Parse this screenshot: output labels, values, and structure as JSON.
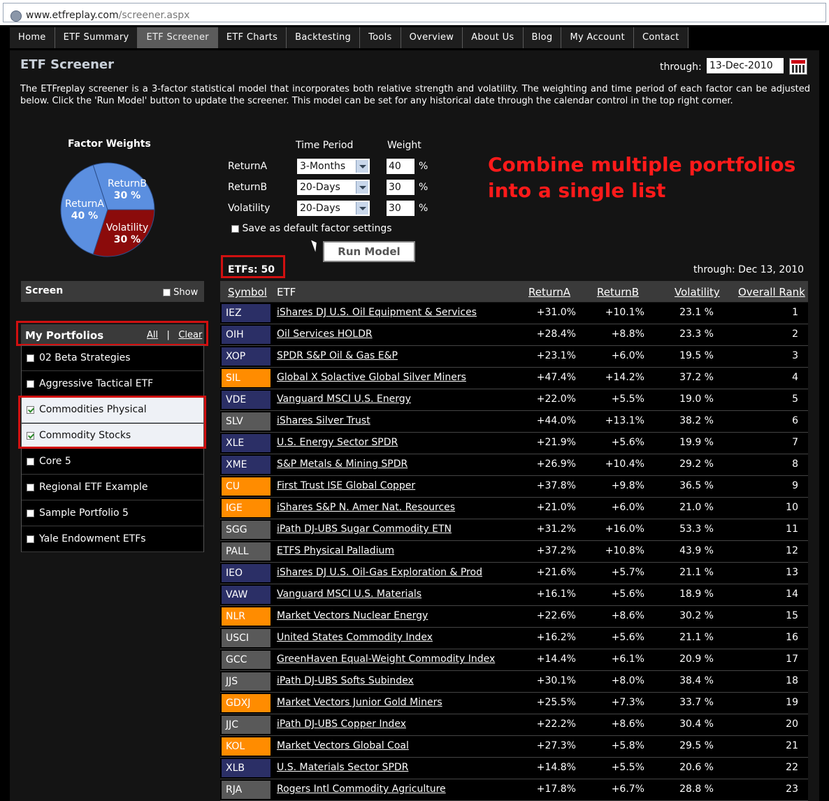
{
  "browser": {
    "url_domain": "www.etfreplay.com",
    "url_path": "/screener.aspx"
  },
  "nav": [
    "Home",
    "ETF Summary",
    "ETF Screener",
    "ETF Charts",
    "Backtesting",
    "Tools",
    "Overview",
    "About Us",
    "Blog",
    "My Account",
    "Contact"
  ],
  "nav_active": "ETF Screener",
  "page": {
    "title": "ETF Screener",
    "through_label": "through:",
    "through_date": "13-Dec-2010",
    "intro": "The ETFreplay screener is a 3-factor statistical model that incorporates both relative strength and volatility. The weighting and time period of each factor can be adjusted below. Click the 'Run Model' button to update the screener. This model can be set for any historical date through the calendar control in the top right corner."
  },
  "factor_weights": {
    "title": "Factor Weights",
    "slices": [
      {
        "name": "ReturnA",
        "pct_label": "40 %",
        "value": 40,
        "color": "#5b8fe0"
      },
      {
        "name": "ReturnB",
        "pct_label": "30 %",
        "value": 30,
        "color": "#5b8fe0"
      },
      {
        "name": "Volatility",
        "pct_label": "30 %",
        "value": 30,
        "color": "#8b0b0b"
      }
    ]
  },
  "factors": {
    "time_period_header": "Time Period",
    "weight_header": "Weight",
    "rows": [
      {
        "label": "ReturnA",
        "period": "3-Months",
        "weight": "40",
        "unit": "%"
      },
      {
        "label": "ReturnB",
        "period": "20-Days",
        "weight": "30",
        "unit": "%"
      },
      {
        "label": "Volatility",
        "period": "20-Days",
        "weight": "30",
        "unit": "%"
      }
    ],
    "save_default_label": "Save as default factor settings",
    "run_button": "Run Model"
  },
  "annotation": {
    "line1": "Combine multiple portfolios",
    "line2": "into a single list"
  },
  "results": {
    "count_label": "ETFs: 50",
    "through_label": "through: Dec 13, 2010"
  },
  "screen": {
    "title": "Screen",
    "show_label": "Show"
  },
  "portfolios": {
    "title": "My Portfolios",
    "all_link": "All",
    "separator": "|",
    "clear_link": "Clear",
    "items": [
      {
        "label": "02 Beta Strategies",
        "checked": false
      },
      {
        "label": "Aggressive Tactical ETF",
        "checked": false
      },
      {
        "label": "Commodities Physical",
        "checked": true
      },
      {
        "label": "Commodity Stocks",
        "checked": true
      },
      {
        "label": "Core 5",
        "checked": false
      },
      {
        "label": "Regional ETF Example",
        "checked": false
      },
      {
        "label": "Sample Portfolio 5",
        "checked": false
      },
      {
        "label": "Yale Endowment ETFs",
        "checked": false
      }
    ]
  },
  "table": {
    "headers": {
      "symbol": "Symbol",
      "etf": "ETF",
      "returnA": "ReturnA",
      "returnB": "ReturnB",
      "volatility": "Volatility",
      "rank": "Overall Rank"
    },
    "symbol_colors": {
      "navy": "#2b2f66",
      "orange": "#ff8c00",
      "gray": "#595959"
    },
    "rows": [
      {
        "symbol": "IEZ",
        "color": "navy",
        "name": "iShares DJ U.S. Oil Equipment & Services",
        "returnA": "+31.0%",
        "returnB": "+10.1%",
        "volatility": "23.1 %",
        "rank": "1"
      },
      {
        "symbol": "OIH",
        "color": "navy",
        "name": "Oil Services HOLDR",
        "returnA": "+28.4%",
        "returnB": "+8.8%",
        "volatility": "23.3 %",
        "rank": "2"
      },
      {
        "symbol": "XOP",
        "color": "navy",
        "name": "SPDR S&P Oil & Gas E&P",
        "returnA": "+23.1%",
        "returnB": "+6.0%",
        "volatility": "19.5 %",
        "rank": "3"
      },
      {
        "symbol": "SIL",
        "color": "orange",
        "name": "Global X Solactive Global Silver Miners",
        "returnA": "+47.4%",
        "returnB": "+14.2%",
        "volatility": "37.2 %",
        "rank": "4"
      },
      {
        "symbol": "VDE",
        "color": "navy",
        "name": "Vanguard MSCI U.S. Energy",
        "returnA": "+22.0%",
        "returnB": "+5.5%",
        "volatility": "19.0 %",
        "rank": "5"
      },
      {
        "symbol": "SLV",
        "color": "gray",
        "name": "iShares Silver Trust",
        "returnA": "+44.0%",
        "returnB": "+13.1%",
        "volatility": "38.2 %",
        "rank": "6"
      },
      {
        "symbol": "XLE",
        "color": "navy",
        "name": "U.S. Energy Sector SPDR",
        "returnA": "+21.9%",
        "returnB": "+5.6%",
        "volatility": "19.9 %",
        "rank": "7"
      },
      {
        "symbol": "XME",
        "color": "navy",
        "name": "S&P Metals & Mining SPDR",
        "returnA": "+26.9%",
        "returnB": "+10.4%",
        "volatility": "29.2 %",
        "rank": "8"
      },
      {
        "symbol": "CU",
        "color": "orange",
        "name": "First Trust ISE Global Copper",
        "returnA": "+37.8%",
        "returnB": "+9.8%",
        "volatility": "36.5 %",
        "rank": "9"
      },
      {
        "symbol": "IGE",
        "color": "orange",
        "name": "iShares S&P N. Amer Nat. Resources",
        "returnA": "+21.0%",
        "returnB": "+6.0%",
        "volatility": "21.0 %",
        "rank": "10"
      },
      {
        "symbol": "SGG",
        "color": "gray",
        "name": "iPath DJ-UBS Sugar Commodity ETN",
        "returnA": "+31.2%",
        "returnB": "+16.0%",
        "volatility": "53.3 %",
        "rank": "11"
      },
      {
        "symbol": "PALL",
        "color": "gray",
        "name": "ETFS Physical Palladium",
        "returnA": "+37.2%",
        "returnB": "+10.8%",
        "volatility": "43.9 %",
        "rank": "12"
      },
      {
        "symbol": "IEO",
        "color": "navy",
        "name": "iShares DJ U.S. Oil-Gas Exploration & Prod",
        "returnA": "+21.6%",
        "returnB": "+5.7%",
        "volatility": "21.1 %",
        "rank": "13"
      },
      {
        "symbol": "VAW",
        "color": "navy",
        "name": "Vanguard MSCI U.S. Materials",
        "returnA": "+16.1%",
        "returnB": "+5.6%",
        "volatility": "18.9 %",
        "rank": "14"
      },
      {
        "symbol": "NLR",
        "color": "orange",
        "name": "Market Vectors Nuclear Energy",
        "returnA": "+22.6%",
        "returnB": "+8.6%",
        "volatility": "30.2 %",
        "rank": "15"
      },
      {
        "symbol": "USCI",
        "color": "gray",
        "name": "United States Commodity Index",
        "returnA": "+16.2%",
        "returnB": "+5.6%",
        "volatility": "21.1 %",
        "rank": "16"
      },
      {
        "symbol": "GCC",
        "color": "gray",
        "name": "GreenHaven Equal-Weight Commodity Index",
        "returnA": "+14.4%",
        "returnB": "+6.1%",
        "volatility": "20.9 %",
        "rank": "17"
      },
      {
        "symbol": "JJS",
        "color": "gray",
        "name": "iPath DJ-UBS Softs Subindex",
        "returnA": "+30.1%",
        "returnB": "+8.0%",
        "volatility": "38.4 %",
        "rank": "18"
      },
      {
        "symbol": "GDXJ",
        "color": "orange",
        "name": "Market Vectors Junior Gold Miners",
        "returnA": "+25.5%",
        "returnB": "+7.3%",
        "volatility": "33.7 %",
        "rank": "19"
      },
      {
        "symbol": "JJC",
        "color": "gray",
        "name": "iPath DJ-UBS Copper Index",
        "returnA": "+22.2%",
        "returnB": "+8.6%",
        "volatility": "30.4 %",
        "rank": "20"
      },
      {
        "symbol": "KOL",
        "color": "orange",
        "name": "Market Vectors Global Coal",
        "returnA": "+27.3%",
        "returnB": "+5.8%",
        "volatility": "29.5 %",
        "rank": "21"
      },
      {
        "symbol": "XLB",
        "color": "navy",
        "name": "U.S. Materials Sector SPDR",
        "returnA": "+14.8%",
        "returnB": "+5.5%",
        "volatility": "20.6 %",
        "rank": "22"
      },
      {
        "symbol": "RJA",
        "color": "gray",
        "name": "Rogers Intl Commodity Agriculture",
        "returnA": "+17.8%",
        "returnB": "+6.7%",
        "volatility": "28.8 %",
        "rank": "23"
      }
    ]
  }
}
